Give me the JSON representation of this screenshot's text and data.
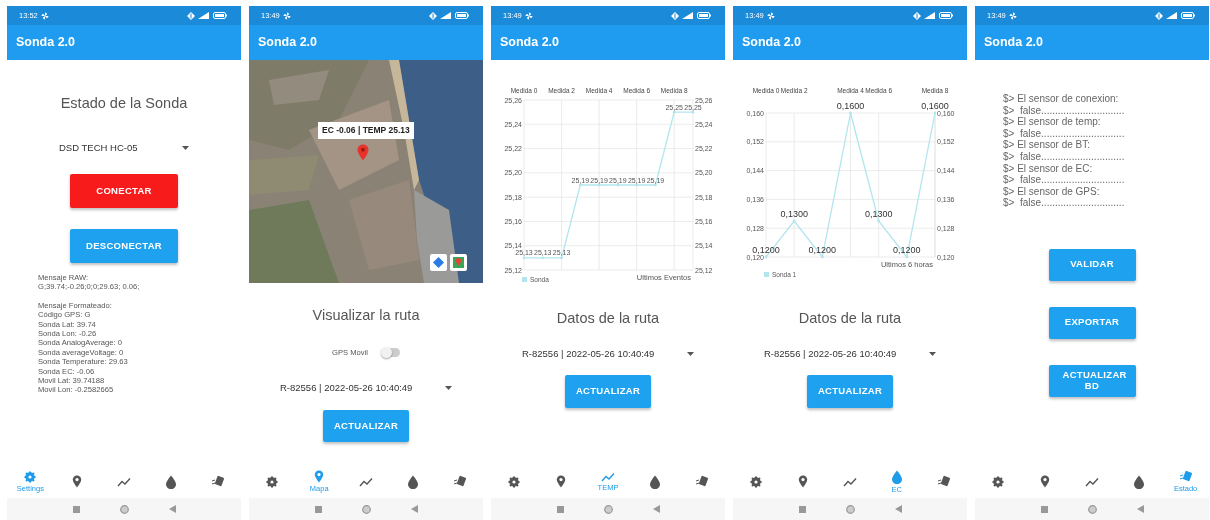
{
  "screens": [
    {
      "kind": "settings",
      "status_time": "13:52",
      "title": "Sonda 2.0",
      "heading": "Estado de la Sonda",
      "device_select": {
        "value": "DSD TECH HC-05"
      },
      "buttons": [
        {
          "label": "CONECTAR",
          "kind": "danger"
        },
        {
          "label": "DESCONECTAR",
          "kind": "primary"
        }
      ],
      "raw": {
        "label": "Mensaje RAW:",
        "value": "G;39.74;-0.26;0;0;29.63; 0.06;"
      },
      "formatted": {
        "label": "Mensaje Formateado:",
        "lines": [
          "Código GPS: G",
          "Sonda Lat: 39.74",
          "Sonda Lon: -0.26",
          "Sonda AnalogAverage: 0",
          "Sonda averageVoltage: 0",
          "Sonda Temperature: 29.63",
          "Sonda EC: -0.06",
          "Movil Lat: 39.74188",
          "Movil Lon: -0.2582665"
        ]
      },
      "nav": [
        {
          "kind": "gear",
          "label": "Settings",
          "selected": true
        },
        {
          "kind": "pin",
          "selected": false
        },
        {
          "kind": "trend",
          "selected": false
        },
        {
          "kind": "drop",
          "selected": false
        },
        {
          "kind": "sensor",
          "selected": false
        }
      ]
    },
    {
      "kind": "map",
      "status_time": "13:49",
      "title": "Sonda 2.0",
      "map": {
        "kind": "picture",
        "callout": "EC -0.06 | TEMP 25.13"
      },
      "heading": "Visualizar la ruta",
      "switch": {
        "label": "GPS Movil",
        "on": false
      },
      "route_select": {
        "value": "R-82556 | 2022-05-26 10:40:49"
      },
      "button": "ACTUALIZAR",
      "nav": [
        {
          "kind": "gear",
          "selected": false
        },
        {
          "kind": "pin",
          "label": "Mapa",
          "selected": true
        },
        {
          "kind": "trend",
          "selected": false
        },
        {
          "kind": "drop",
          "selected": false
        },
        {
          "kind": "sensor",
          "selected": false
        }
      ]
    },
    {
      "kind": "chart",
      "status_time": "13:49",
      "title": "Sonda 2.0",
      "chart_data": {
        "type": "line",
        "grid": true,
        "categories": [
          "Medida 0",
          null,
          "Medida 2",
          null,
          "Medida 4",
          null,
          "Medida 6",
          null,
          "Medida 8",
          null
        ],
        "ylim": [
          25.12,
          25.26
        ],
        "yticks": [
          {
            "value": 25.12,
            "label": "25,12"
          },
          {
            "value": 25.14,
            "label": "25,14"
          },
          {
            "value": 25.16,
            "label": "25,16"
          },
          {
            "value": 25.18,
            "label": "25,18"
          },
          {
            "value": 25.2,
            "label": "25,20"
          },
          {
            "value": 25.22,
            "label": "25,22"
          },
          {
            "value": 25.24,
            "label": "25,24"
          },
          {
            "value": 25.26,
            "label": "25,26"
          }
        ],
        "series": [
          {
            "name": "Sonda",
            "color": "#b2e6ee",
            "values": [
              25.13,
              25.13,
              25.13,
              25.19,
              25.19,
              25.19,
              25.19,
              25.19,
              25.25,
              25.25
            ]
          }
        ],
        "value_labels": [
          "25,13",
          "25,13",
          "25,13",
          "25,19",
          "25,19",
          "25,19",
          "25,19",
          "25,19",
          "25,25",
          "25,25"
        ],
        "annotations": [
          "Ultimos Eventos"
        ]
      },
      "heading": "Datos de la ruta",
      "route_select": {
        "value": "R-82556 | 2022-05-26 10:40:49"
      },
      "button": "ACTUALIZAR",
      "nav": [
        {
          "kind": "gear",
          "selected": false
        },
        {
          "kind": "pin",
          "selected": false
        },
        {
          "kind": "trend",
          "label": "TEMP",
          "selected": true
        },
        {
          "kind": "drop",
          "selected": false
        },
        {
          "kind": "sensor",
          "selected": false
        }
      ]
    },
    {
      "kind": "chart",
      "status_time": "13:49",
      "title": "Sonda 2.0",
      "chart_data": {
        "type": "line",
        "grid": true,
        "categories": [
          "Medida 0",
          "Medida 2",
          null,
          "Medida 4",
          "Medida 6",
          null,
          "Medida 8"
        ],
        "ylim": [
          0.12,
          0.16
        ],
        "yticks": [
          {
            "value": 0.12,
            "label": "0,120"
          },
          {
            "value": 0.128,
            "label": "0,128"
          },
          {
            "value": 0.136,
            "label": "0,136"
          },
          {
            "value": 0.144,
            "label": "0,144"
          },
          {
            "value": 0.152,
            "label": "0,152"
          },
          {
            "value": 0.16,
            "label": "0,160"
          }
        ],
        "series": [
          {
            "name": "Sonda 1",
            "color": "#b2e6ee",
            "values": [
              0.12,
              0.13,
              0.12,
              0.16,
              0.13,
              0.12,
              0.16
            ]
          }
        ],
        "value_labels": [
          "0,1200",
          "0,1300",
          "0,1200",
          "0,1600",
          "0,1300",
          "0,1200",
          "0,1600"
        ],
        "annotations": [
          "Ultimos 6 horas"
        ]
      },
      "heading": "Datos de la ruta",
      "route_select": {
        "value": "R-82556 | 2022-05-26 10:40:49"
      },
      "button": "ACTUALIZAR",
      "nav": [
        {
          "kind": "gear",
          "selected": false
        },
        {
          "kind": "pin",
          "selected": false
        },
        {
          "kind": "trend",
          "selected": false
        },
        {
          "kind": "drop",
          "label": "EC",
          "selected": true
        },
        {
          "kind": "sensor",
          "selected": false
        }
      ]
    },
    {
      "kind": "status",
      "status_time": "13:49",
      "title": "Sonda 2.0",
      "console": [
        "$> El sensor de conexion:",
        "$>  false..............................",
        "$> El sensor de temp:",
        "$>  false..............................",
        "$> El sensor de BT:",
        "$>  false..............................",
        "$> El sensor de EC:",
        "$>  false..............................",
        "$> El sensor de GPS:",
        "$>  false.............................."
      ],
      "buttons": [
        "VALIDAR",
        "EXPORTAR",
        "ACTUALIZAR BD"
      ],
      "nav": [
        {
          "kind": "gear",
          "selected": false
        },
        {
          "kind": "pin",
          "selected": false
        },
        {
          "kind": "trend",
          "selected": false
        },
        {
          "kind": "drop",
          "selected": false
        },
        {
          "kind": "sensor",
          "label": "Estado",
          "selected": true
        }
      ]
    }
  ]
}
